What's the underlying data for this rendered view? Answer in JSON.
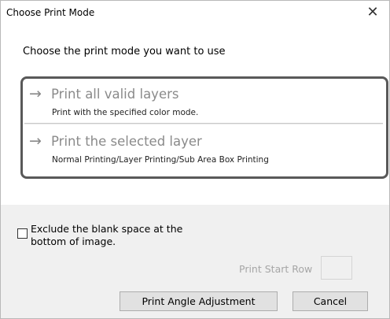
{
  "window": {
    "title": "Choose Print Mode",
    "close_glyph": "✕"
  },
  "instruction": "Choose the print mode you want to use",
  "options": [
    {
      "arrow": "→",
      "title": "Print all valid layers",
      "description": "Print with the specified color mode."
    },
    {
      "arrow": "→",
      "title": "Print the selected layer",
      "description": "Normal Printing/Layer Printing/Sub Area Box Printing"
    }
  ],
  "exclude_blank": {
    "label": "Exclude the blank space at the bottom of image.",
    "checked": false
  },
  "print_start_row": {
    "label": "Print Start Row",
    "value": "",
    "enabled": false
  },
  "buttons": {
    "angle_adjustment": "Print Angle Adjustment",
    "cancel": "Cancel"
  },
  "colors": {
    "highlight_border": "#595959",
    "option_title": "#8a8a8a",
    "footer_bg": "#f0f0f0"
  }
}
